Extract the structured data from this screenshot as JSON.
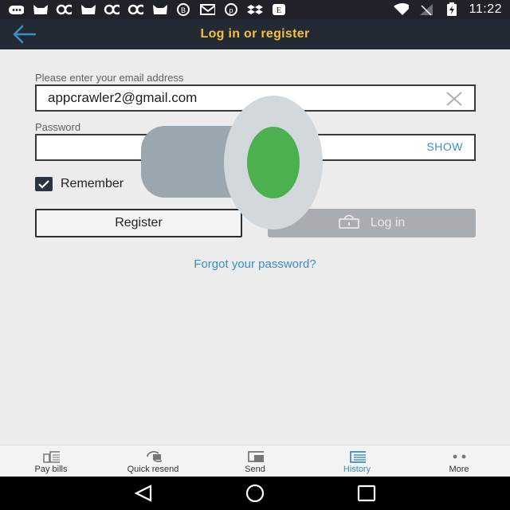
{
  "status_bar": {
    "time": "11:22",
    "left_icons": [
      "chat-icon",
      "cat-icon",
      "glasses-icon",
      "cat-icon",
      "glasses-icon",
      "glasses-icon",
      "cat-icon",
      "bitcoin-icon",
      "mail-icon",
      "pinterest-icon",
      "dropbox-icon",
      "e-icon"
    ],
    "right_icons": [
      "wifi-icon",
      "signal-icon",
      "battery-icon"
    ]
  },
  "app_bar": {
    "title": "Log in or register",
    "back_icon": "arrow-left-icon"
  },
  "form": {
    "email_label": "Please enter your email address",
    "email_value": "appcrawler2@gmail.com",
    "password_label": "Password",
    "password_value": "",
    "show_label": "SHOW",
    "remember_label": "Remember",
    "register_label": "Register",
    "login_label": "Log in",
    "forgot_label": "Forgot your password?"
  },
  "bottom_nav": {
    "items": [
      {
        "label": "Pay bills",
        "icon": "bills-icon"
      },
      {
        "label": "Quick resend",
        "icon": "resend-icon"
      },
      {
        "label": "Send",
        "icon": "send-icon"
      },
      {
        "label": "History",
        "icon": "history-icon"
      },
      {
        "label": "More",
        "icon": "more-icon"
      }
    ],
    "active_index": 3
  },
  "colors": {
    "accent": "#3b8fc5",
    "title": "#f2c33a",
    "app_bar": "#232a33",
    "overlay_green": "#4caf50"
  }
}
